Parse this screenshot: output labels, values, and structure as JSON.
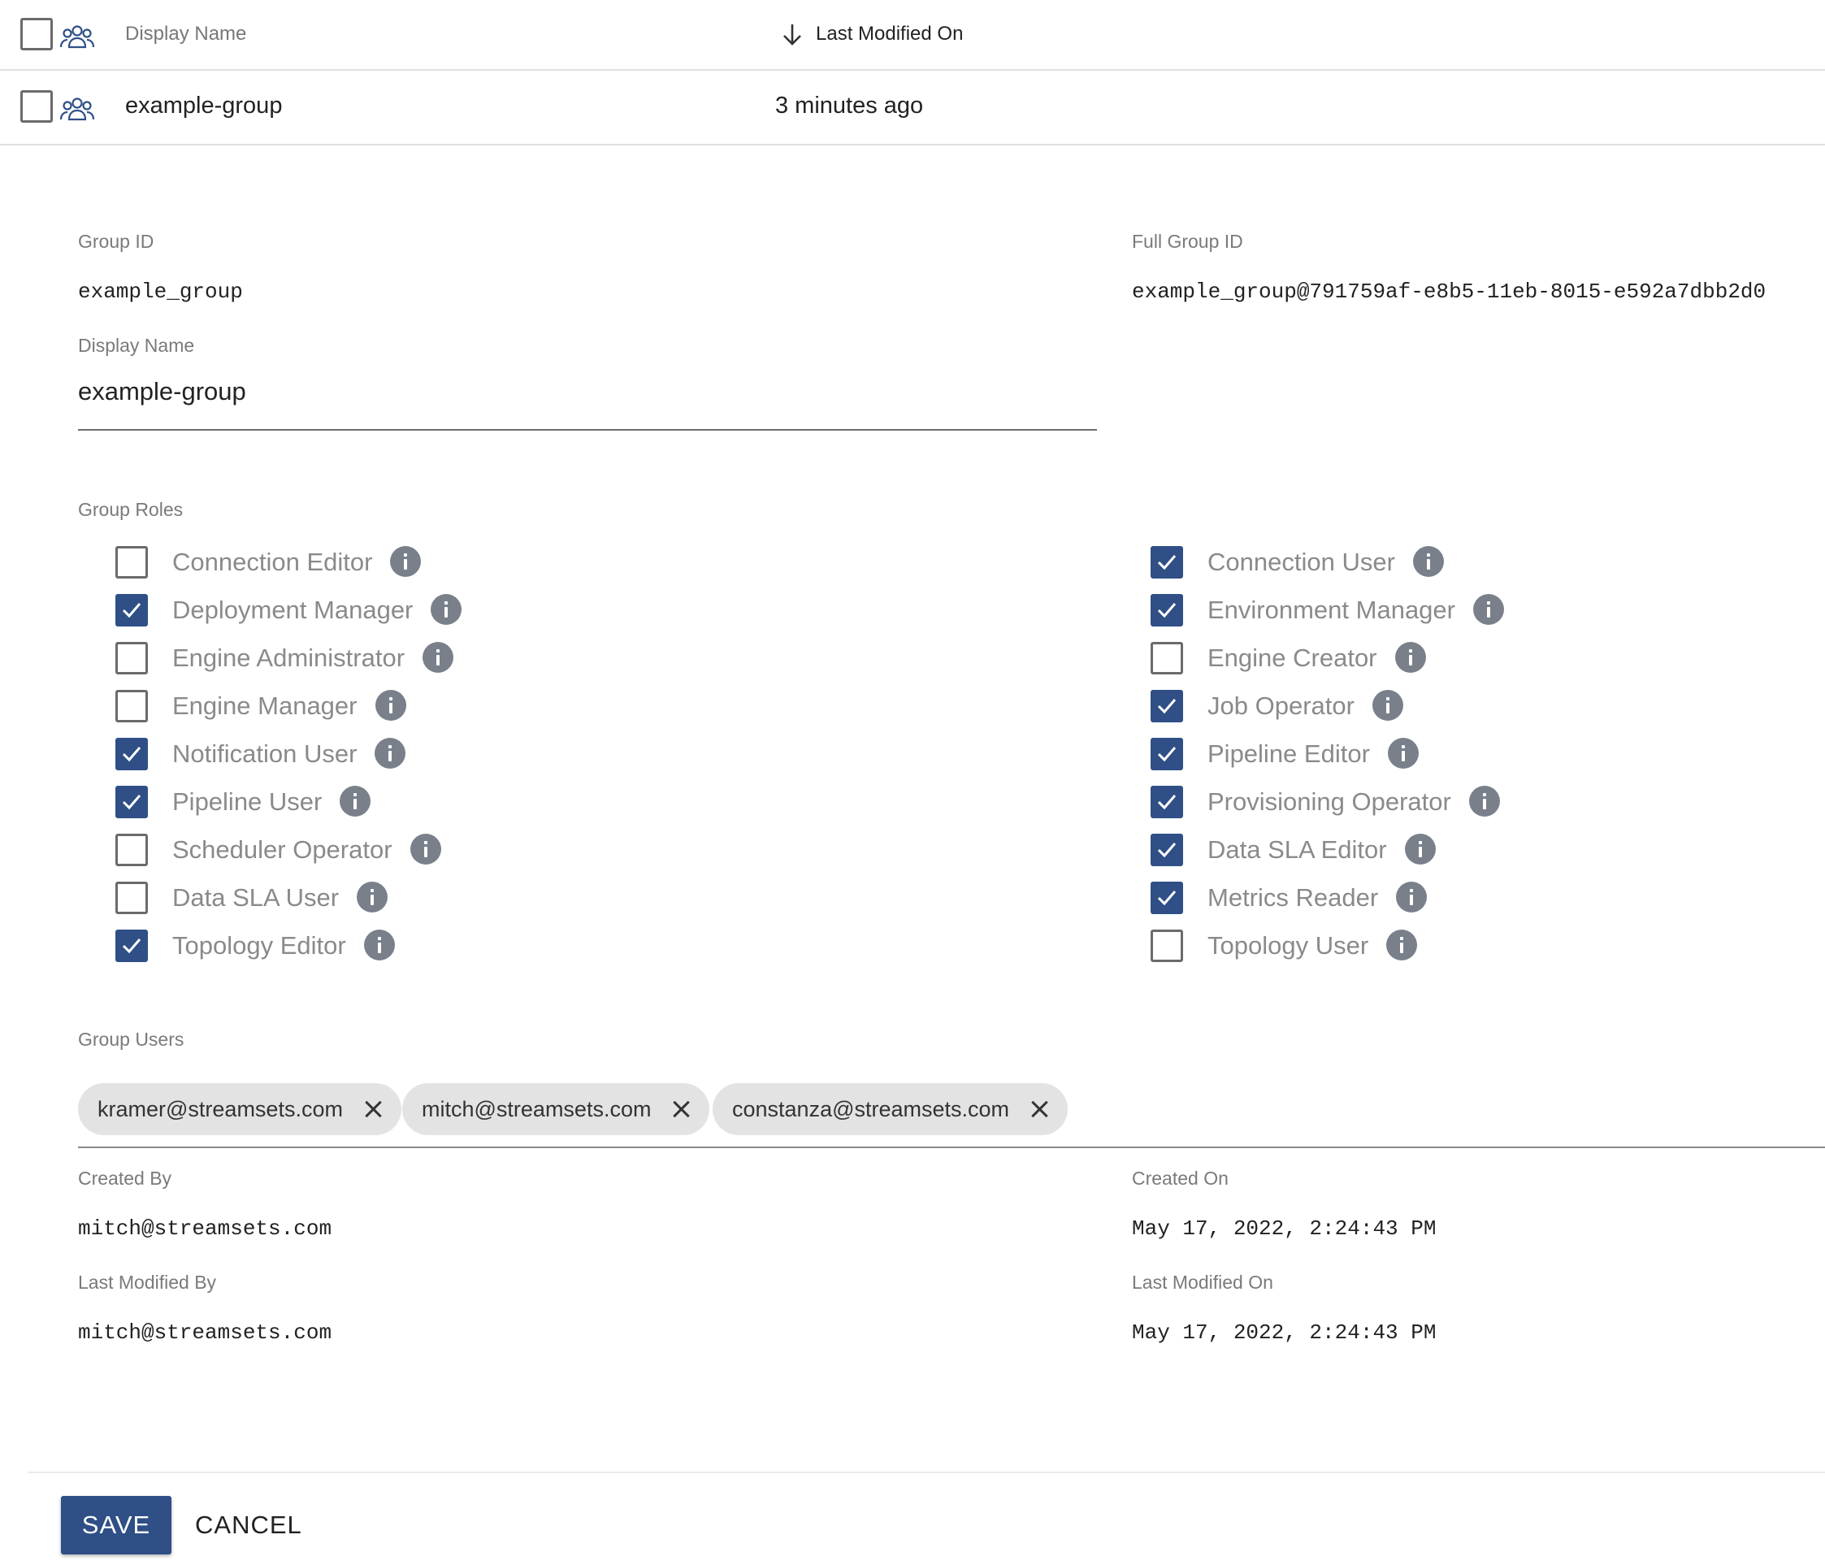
{
  "table": {
    "header": {
      "display_name": "Display Name",
      "last_modified": "Last Modified On"
    },
    "row": {
      "display_name": "example-group",
      "last_modified": "3 minutes ago"
    }
  },
  "detail": {
    "group_id_label": "Group ID",
    "group_id_value": "example_group",
    "full_group_id_label": "Full Group ID",
    "full_group_id_value": "example_group@791759af-e8b5-11eb-8015-e592a7dbb2d0",
    "display_name_label": "Display Name",
    "display_name_value": "example-group",
    "roles_label": "Group Roles",
    "roles_left": [
      {
        "label": "Connection Editor",
        "checked": false
      },
      {
        "label": "Deployment Manager",
        "checked": true
      },
      {
        "label": "Engine Administrator",
        "checked": false
      },
      {
        "label": "Engine Manager",
        "checked": false
      },
      {
        "label": "Notification User",
        "checked": true
      },
      {
        "label": "Pipeline User",
        "checked": true
      },
      {
        "label": "Scheduler Operator",
        "checked": false
      },
      {
        "label": "Data SLA User",
        "checked": false
      },
      {
        "label": "Topology Editor",
        "checked": true
      }
    ],
    "roles_right": [
      {
        "label": "Connection User",
        "checked": true
      },
      {
        "label": "Environment Manager",
        "checked": true
      },
      {
        "label": "Engine Creator",
        "checked": false
      },
      {
        "label": "Job Operator",
        "checked": true
      },
      {
        "label": "Pipeline Editor",
        "checked": true
      },
      {
        "label": "Provisioning Operator",
        "checked": true
      },
      {
        "label": "Data SLA Editor",
        "checked": true
      },
      {
        "label": "Metrics Reader",
        "checked": true
      },
      {
        "label": "Topology User",
        "checked": false
      }
    ],
    "users_label": "Group Users",
    "users": [
      "kramer@streamsets.com",
      "mitch@streamsets.com",
      "constanza@streamsets.com"
    ],
    "created_by_label": "Created By",
    "created_by_value": "mitch@streamsets.com",
    "created_on_label": "Created On",
    "created_on_value": "May 17, 2022, 2:24:43 PM",
    "modified_by_label": "Last Modified By",
    "modified_by_value": "mitch@streamsets.com",
    "modified_on_label": "Last Modified On",
    "modified_on_value": "May 17, 2022, 2:24:43 PM"
  },
  "actions": {
    "save": "SAVE",
    "cancel": "CANCEL"
  },
  "colors": {
    "accent": "#2f4f86",
    "chip_bg": "#e3e3e3",
    "info_icon": "#7a808a"
  }
}
